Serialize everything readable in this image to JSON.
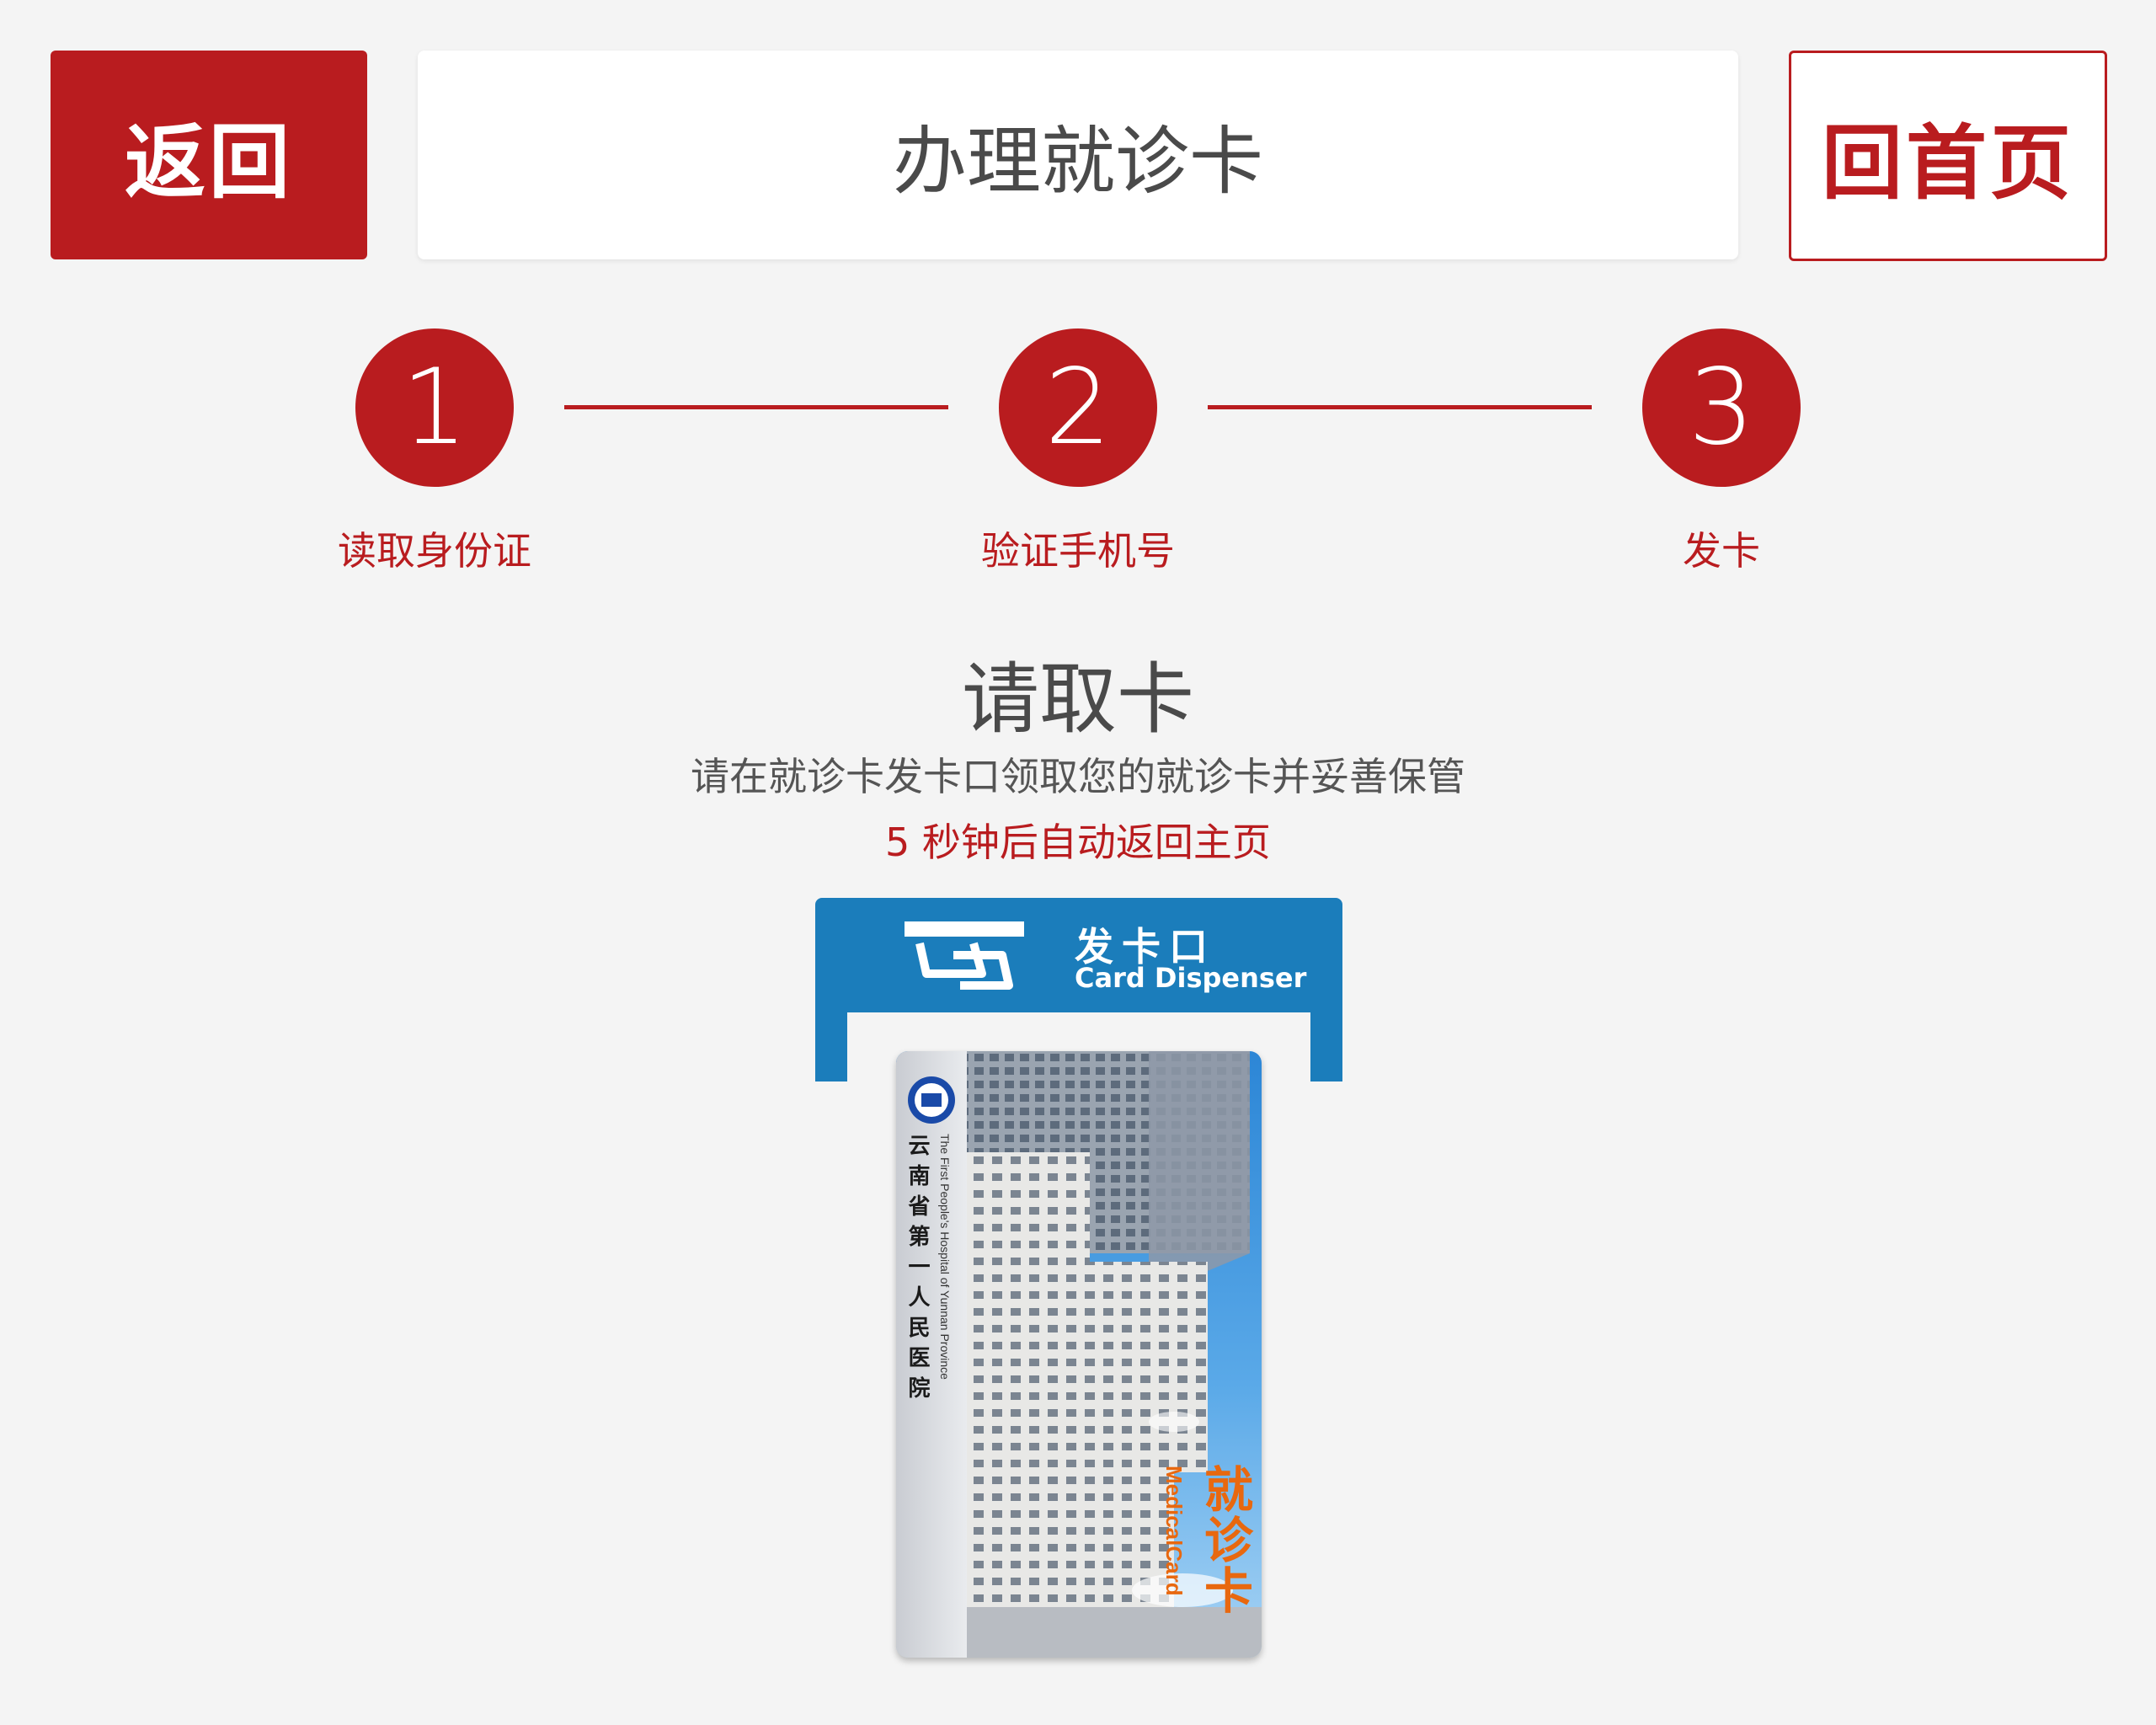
{
  "header": {
    "back_label": "返回",
    "title": "办理就诊卡",
    "home_label": "回首页"
  },
  "steps": [
    {
      "number": "1",
      "label": "读取身份证"
    },
    {
      "number": "2",
      "label": "验证手机号"
    },
    {
      "number": "3",
      "label": "发卡"
    }
  ],
  "main": {
    "heading": "请取卡",
    "instruction": "请在就诊卡发卡口领取您的就诊卡并妥善保管",
    "countdown": "5 秒钟后自动返回主页"
  },
  "dispenser": {
    "label_cn": "发卡口",
    "label_en": "Card Dispenser"
  },
  "card": {
    "hospital_cn": "云南省第一人民医院",
    "hospital_en": "The First People's Hospital of Yunnan Province",
    "card_name_cn": "就诊卡",
    "card_name_en": "MedicalCard"
  },
  "colors": {
    "accent": "#b91c1f",
    "dispenser_blue": "#1b7dbb",
    "card_title_orange": "#e8680f"
  }
}
